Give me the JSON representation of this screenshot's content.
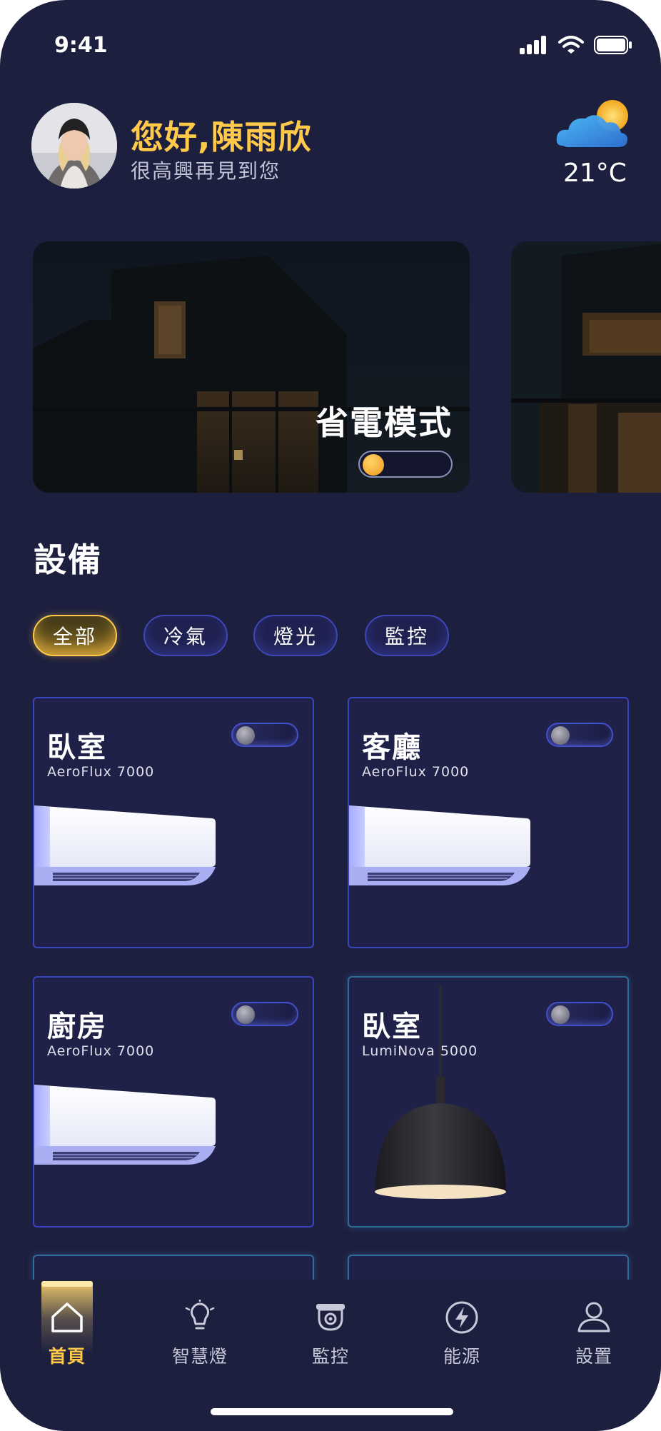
{
  "status_bar": {
    "time": "9:41"
  },
  "header": {
    "greeting": "您好,陳雨欣",
    "subtitle": "很高興再見到您",
    "weather": {
      "icon": "cloud-sun-icon",
      "temperature": "21°C"
    }
  },
  "banners": [
    {
      "title": "省電模式",
      "toggle_on": true
    }
  ],
  "devices_section": {
    "title": "設備",
    "filters": [
      {
        "label": "全部",
        "active": true
      },
      {
        "label": "冷氣",
        "active": false
      },
      {
        "label": "燈光",
        "active": false
      },
      {
        "label": "監控",
        "active": false
      }
    ]
  },
  "devices": [
    {
      "room": "臥室",
      "model": "AeroFlux 7000",
      "type": "air-conditioner",
      "on": false
    },
    {
      "room": "客廳",
      "model": "AeroFlux 7000",
      "type": "air-conditioner",
      "on": false
    },
    {
      "room": "廚房",
      "model": "AeroFlux 7000",
      "type": "air-conditioner",
      "on": false
    },
    {
      "room": "臥室",
      "model": "LumiNova 5000",
      "type": "pendant-lamp",
      "on": false
    }
  ],
  "bottom_nav": [
    {
      "label": "首頁",
      "icon": "home-icon",
      "active": true
    },
    {
      "label": "智慧燈",
      "icon": "lightbulb-icon",
      "active": false
    },
    {
      "label": "監控",
      "icon": "camera-icon",
      "active": false
    },
    {
      "label": "能源",
      "icon": "lightning-icon",
      "active": false
    },
    {
      "label": "設置",
      "icon": "user-icon",
      "active": false
    }
  ],
  "colors": {
    "background": "#1d1f3f",
    "accent": "#ffc94a",
    "card_border": "#3a44c0",
    "chip_border": "#3d47b8"
  }
}
